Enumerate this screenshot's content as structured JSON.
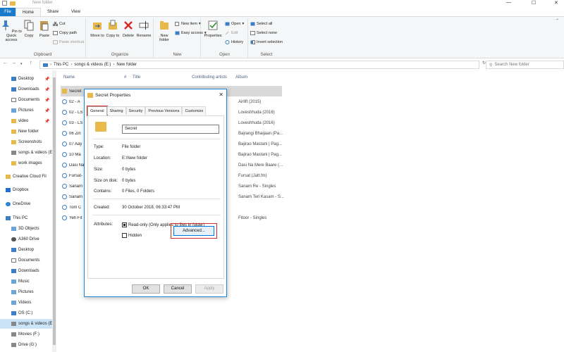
{
  "window": {
    "title": "New folder",
    "controls": {
      "minimize": "—",
      "maximize": "☐",
      "close": "✕"
    }
  },
  "ribbon_tabs": [
    {
      "label": "File"
    },
    {
      "label": "Home"
    },
    {
      "label": "Share"
    },
    {
      "label": "View"
    }
  ],
  "ribbon": {
    "clipboard": {
      "label": "Clipboard",
      "pin_to_quick_access": "Pin to Quick access",
      "copy": "Copy",
      "paste": "Paste",
      "cut": "Cut",
      "copy_path": "Copy path",
      "paste_shortcut": "Paste shortcut"
    },
    "organize": {
      "label": "Organize",
      "move_to": "Move to",
      "copy_to": "Copy to",
      "delete": "Delete",
      "rename": "Rename"
    },
    "new": {
      "label": "New",
      "new_folder": "New folder",
      "new_item": "New item",
      "easy_access": "Easy access"
    },
    "open": {
      "label": "Open",
      "properties": "Properties",
      "open": "Open",
      "edit": "Edit",
      "history": "History"
    },
    "select": {
      "label": "Select",
      "select_all": "Select all",
      "select_none": "Select none",
      "invert_selection": "Invert selection"
    }
  },
  "address": {
    "crumbs": [
      "This PC",
      "songs & videos (E:)",
      "New folder"
    ],
    "search_placeholder": "Search New folder"
  },
  "nav_pane": {
    "items": [
      {
        "label": "Desktop",
        "pinned": true
      },
      {
        "label": "Downloads",
        "pinned": true
      },
      {
        "label": "Documents",
        "pinned": true
      },
      {
        "label": "Pictures",
        "pinned": true
      },
      {
        "label": "video",
        "pinned": true
      },
      {
        "label": "New folder"
      },
      {
        "label": "Screenshots"
      },
      {
        "label": "songs & videos (E"
      },
      {
        "label": "work images"
      },
      {
        "label": "Creative Cloud Fil"
      },
      {
        "label": "Dropbox"
      },
      {
        "label": "OneDrive"
      },
      {
        "label": "This PC"
      },
      {
        "label": "3D Objects"
      },
      {
        "label": "A360 Drive"
      },
      {
        "label": "Desktop"
      },
      {
        "label": "Documents"
      },
      {
        "label": "Downloads"
      },
      {
        "label": "Music"
      },
      {
        "label": "Pictures"
      },
      {
        "label": "Videos"
      },
      {
        "label": "OS (C:)"
      },
      {
        "label": "songs & videos (E"
      },
      {
        "label": "Movies (F:)"
      },
      {
        "label": "Drive (G:)"
      }
    ]
  },
  "file_list": {
    "columns": {
      "name": "Name",
      "number": "#",
      "title": "Title",
      "contributing_artists": "Contributing artists",
      "album": "Album"
    },
    "rows": [
      {
        "name": "Secret",
        "album": ""
      },
      {
        "name": "02 - A",
        "album": "Airlift (2015)"
      },
      {
        "name": "02 - LS",
        "album": "Loveshhuda (2016)"
      },
      {
        "name": "03 - LS",
        "album": "Loveshhuda (2016)"
      },
      {
        "name": "06 Zin",
        "album": "Bajrangi Bhaijaan (Pa..."
      },
      {
        "name": "07 Aay",
        "album": "Bajirao Mastani | Pag..."
      },
      {
        "name": "10 Ma",
        "album": "Bajirao Mastani | Pag..."
      },
      {
        "name": "Dasi Na",
        "album": "Dasi Na Mere Baare (..."
      },
      {
        "name": "Fursat-",
        "album": "Fursat (Jatt.fm)"
      },
      {
        "name": "Sanam",
        "album": "Sanam Re - Singles"
      },
      {
        "name": "Sanam",
        "album": "Sanam Teri Kasam - S..."
      },
      {
        "name": "Tom C",
        "album": ""
      },
      {
        "name": "Yeh Fit",
        "album": "Fitoor - Singles"
      }
    ]
  },
  "dialog": {
    "title": "Secret Properties",
    "tabs": [
      "General",
      "Sharing",
      "Security",
      "Previous Versions",
      "Customize"
    ],
    "name_value": "Secret",
    "props": {
      "type_label": "Type:",
      "type_value": "File folder",
      "location_label": "Location:",
      "location_value": "E:\\New folder",
      "size_label": "Size:",
      "size_value": "0 bytes",
      "size_on_disk_label": "Size on disk:",
      "size_on_disk_value": "0 bytes",
      "contains_label": "Contains:",
      "contains_value": "0 Files, 0 Folders",
      "created_label": "Created:",
      "created_value": "30 October 2018, 06:33:47 PM",
      "attributes_label": "Attributes:",
      "readonly_label": "Read-only (Only applies to files in folder)",
      "hidden_label": "Hidden",
      "advanced_label": "Advanced..."
    },
    "buttons": {
      "ok": "OK",
      "cancel": "Cancel",
      "apply": "Apply"
    }
  },
  "colors": {
    "accent": "#1979ca",
    "highlight_box": "#d42a2a",
    "folder": "#e8b84a"
  }
}
